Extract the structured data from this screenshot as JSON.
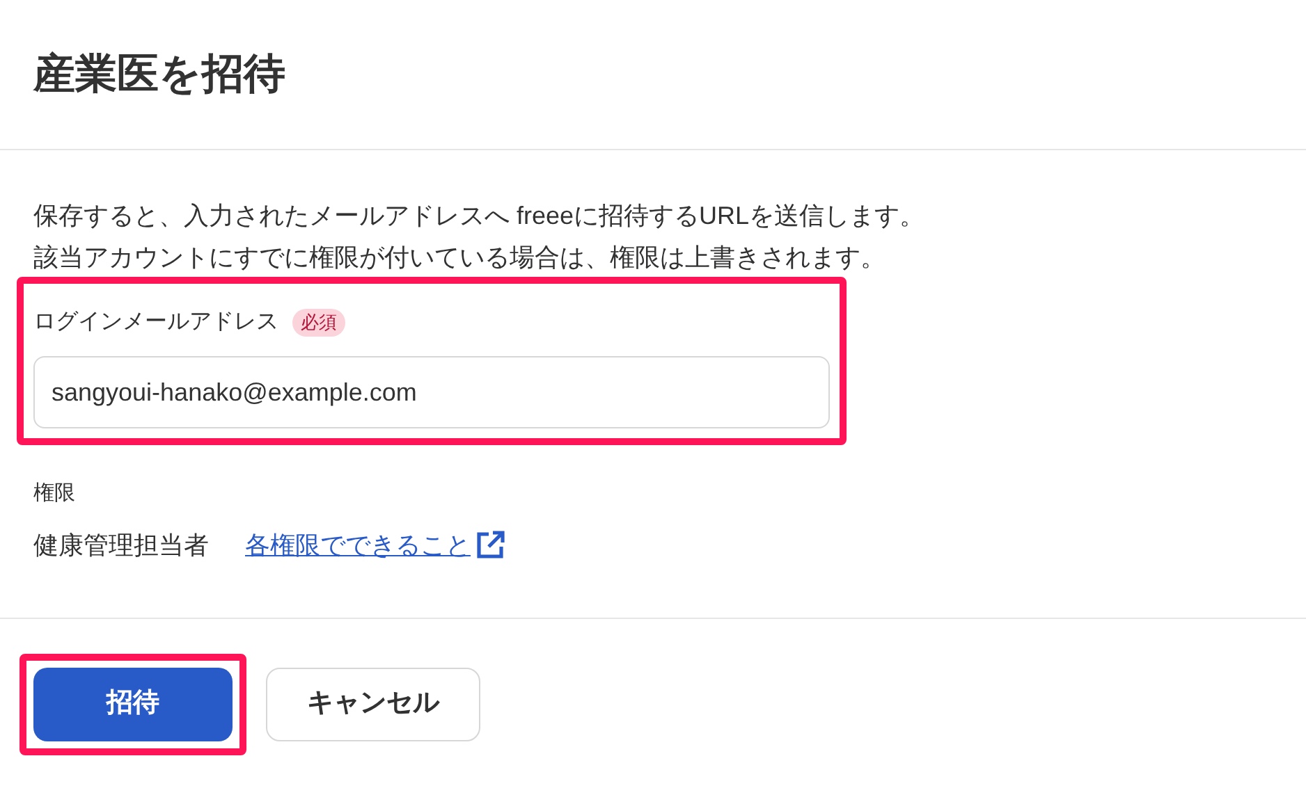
{
  "title": "産業医を招待",
  "description": [
    "保存すると、入力されたメールアドレスへ freeeに招待するURLを送信します。",
    "該当アカウントにすでに権限が付いている場合は、権限は上書きされます。"
  ],
  "email": {
    "label": "ログインメールアドレス",
    "badge": "必須",
    "value": "sangyoui-hanako@example.com",
    "highlighted": true
  },
  "permission": {
    "label": "権限",
    "value": "健康管理担当者",
    "link": "各権限でできること"
  },
  "buttons": [
    {
      "kind": "primary",
      "label": "招待",
      "highlighted": true
    },
    {
      "kind": "secondary",
      "label": "キャンセル",
      "highlighted": false
    }
  ]
}
